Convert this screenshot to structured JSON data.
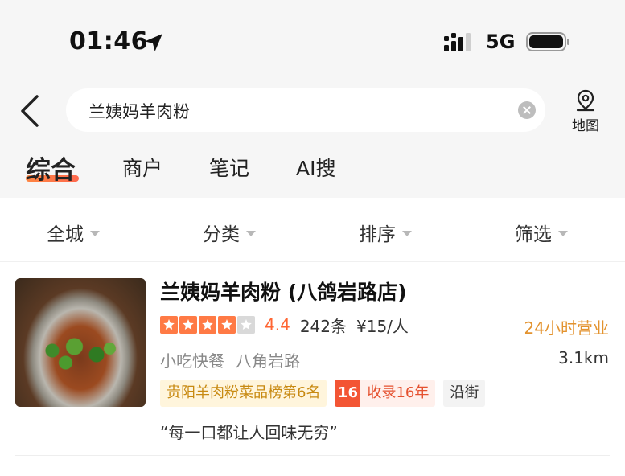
{
  "status_bar": {
    "time": "01:46",
    "network": "5G"
  },
  "search": {
    "query": "兰姨妈羊肉粉",
    "map_label": "地图"
  },
  "tabs": [
    {
      "label": "综合",
      "active": true
    },
    {
      "label": "商户",
      "active": false
    },
    {
      "label": "笔记",
      "active": false
    },
    {
      "label": "AI搜",
      "active": false
    }
  ],
  "filters": [
    {
      "label": "全城"
    },
    {
      "label": "分类"
    },
    {
      "label": "排序"
    },
    {
      "label": "筛选"
    }
  ],
  "result": {
    "name": "兰姨妈羊肉粉 (八鸽岩路店)",
    "star_rating": 4,
    "star_total": 5,
    "score": "4.4",
    "reviews": "242条",
    "price": "¥15/人",
    "hours": "24小时营业",
    "category": "小吃快餐",
    "area": "八角岩路",
    "distance": "3.1km",
    "tag_rank": "贵阳羊肉粉菜品榜第6名",
    "tag_years_num": "16",
    "tag_years_text": "收录16年",
    "tag_street": "沿街",
    "quote": "“每一口都让人回味无穷”"
  },
  "colors": {
    "accent": "#ff6633",
    "hours": "#e3932f",
    "star_filled": "#ff7a45",
    "star_empty": "#d9d9d9"
  }
}
